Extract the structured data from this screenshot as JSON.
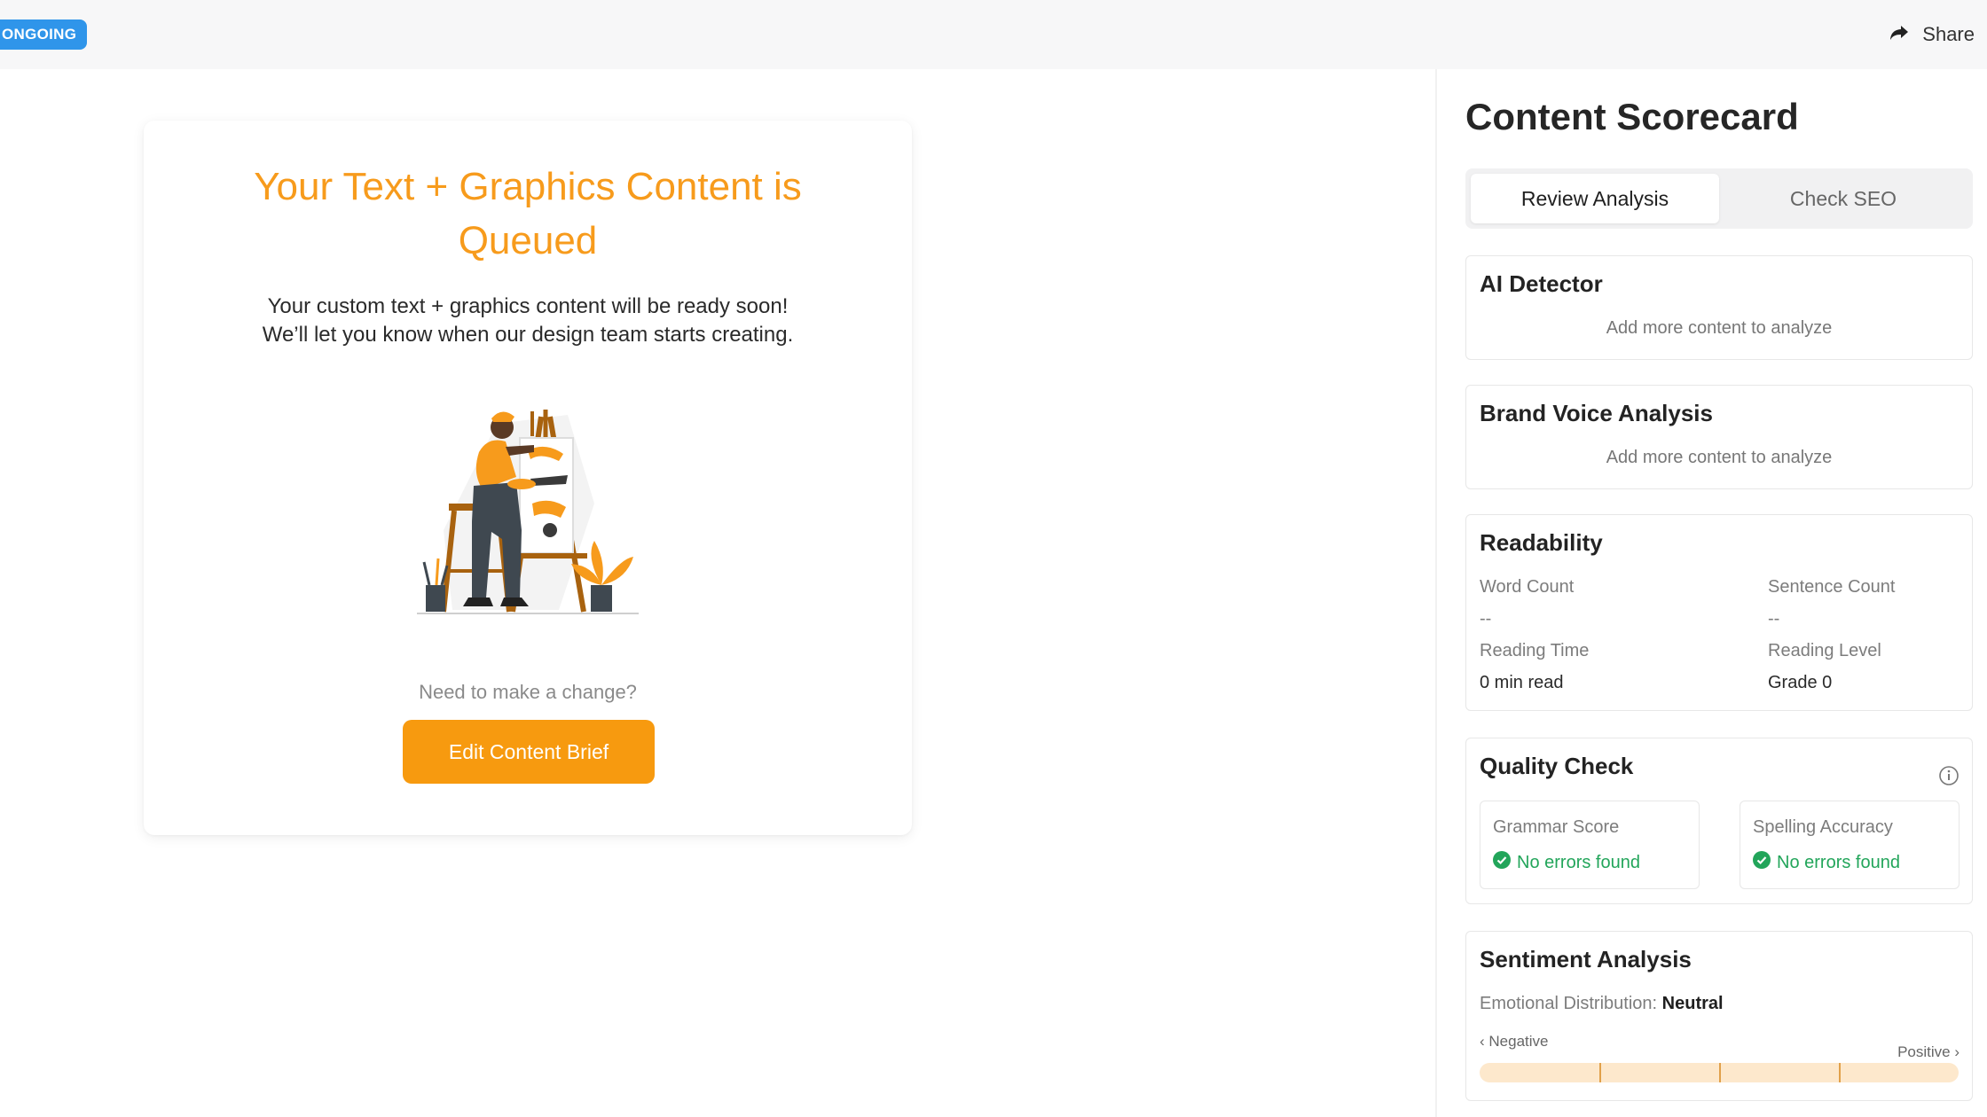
{
  "header": {
    "status_badge": "ONGOING",
    "share_label": "Share"
  },
  "queue_card": {
    "title": "Your Text + Graphics Content is Queued",
    "description_line1": "Your custom text + graphics content will be ready soon!",
    "description_line2": "We’ll let you know when our design team starts creating.",
    "change_prompt": "Need to make a change?",
    "edit_button": "Edit Content Brief"
  },
  "scorecard": {
    "title": "Content Scorecard",
    "tabs": [
      {
        "label": "Review Analysis",
        "active": true
      },
      {
        "label": "Check SEO",
        "active": false
      }
    ],
    "ai_detector": {
      "title": "AI Detector",
      "note": "Add more content to analyze"
    },
    "brand_voice": {
      "title": "Brand Voice Analysis",
      "note": "Add more content to analyze"
    },
    "readability": {
      "title": "Readability",
      "word_count_label": "Word Count",
      "word_count_value": "--",
      "sentence_count_label": "Sentence Count",
      "sentence_count_value": "--",
      "reading_time_label": "Reading Time",
      "reading_time_value": "0 min read",
      "reading_level_label": "Reading Level",
      "reading_level_value": "Grade 0"
    },
    "quality_check": {
      "title": "Quality Check",
      "grammar_label": "Grammar Score",
      "grammar_status": "No errors found",
      "spelling_label": "Spelling Accuracy",
      "spelling_status": "No errors found"
    },
    "sentiment": {
      "title": "Sentiment Analysis",
      "distribution_label": "Emotional Distribution:",
      "distribution_value": "Neutral",
      "negative_label": "‹ Negative",
      "positive_label": "Positive ›"
    }
  },
  "colors": {
    "accent_orange": "#f79b1c",
    "badge_blue": "#2f95ea",
    "success_green": "#22a55a"
  },
  "icons": [
    "share-icon",
    "info-icon",
    "check-circle-icon"
  ]
}
